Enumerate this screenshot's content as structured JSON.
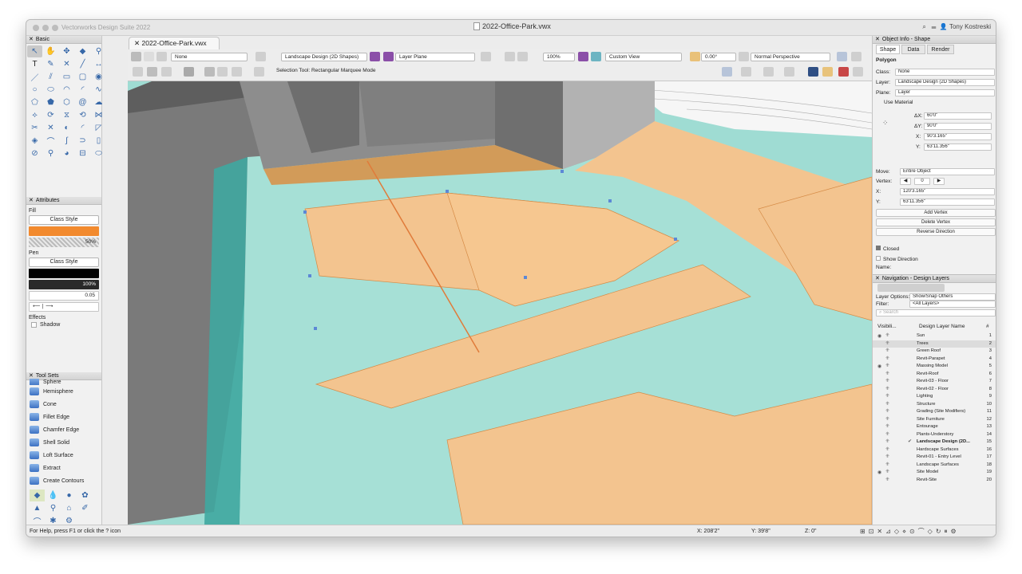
{
  "app": {
    "name": "Vectorworks Design Suite 2022",
    "document": "2022-Office-Park.vwx",
    "user": "Tony Kostreski"
  },
  "palettes": {
    "basic": {
      "title": "Basic"
    },
    "attributes": {
      "title": "Attributes",
      "fill_label": "Fill",
      "fill_style": "Class Style",
      "fill_color": "#f28a2e",
      "opacity": "50%",
      "pen_label": "Pen",
      "pen_style": "Class Style",
      "pen_opacity": "100%",
      "line_weight": "0.05",
      "effects_label": "Effects",
      "shadow_label": "Shadow"
    },
    "toolsets": {
      "title": "Tool Sets",
      "items": [
        "Sphere",
        "Hemisphere",
        "Cone",
        "Fillet Edge",
        "Chamfer Edge",
        "Shell Solid",
        "Loft Surface",
        "Extract",
        "Create Contours"
      ]
    }
  },
  "toolbar": {
    "class_value": "None",
    "layer_value": "Landscape Design (2D Shapes)",
    "plane_value": "Layer Plane",
    "zoom": "100%",
    "view": "Custom View",
    "angle": "0.00°",
    "render": "Normal Perspective",
    "mode_text": "Selection Tool: Rectangular Marquee Mode"
  },
  "object_info": {
    "title": "Object Info - Shape",
    "tabs": [
      "Shape",
      "Data",
      "Render"
    ],
    "type": "Polygon",
    "class_label": "Class:",
    "class_value": "None",
    "layer_label": "Layer:",
    "layer_value": "Landscape Design (2D Shapes)",
    "plane_label": "Plane:",
    "plane_value": "Layer",
    "use_material": "Use Material",
    "dx_label": "ΔX:",
    "dx": "60'0\"",
    "dy_label": "ΔY:",
    "dy": "90'0\"",
    "x_label": "X:",
    "x": "90'3.165\"",
    "y_label": "Y:",
    "y": "63'11.356\"",
    "move_label": "Move:",
    "move_value": "Entire Object",
    "vertex_label": "Vertex:",
    "vertex_value": "0",
    "vx_label": "X:",
    "vx": "120'3.165\"",
    "vy_label": "Y:",
    "vy": "63'11.356\"",
    "buttons": [
      "Add Vertex",
      "Delete Vertex",
      "Reverse Direction"
    ],
    "closed": "Closed",
    "show_direction": "Show Direction",
    "name_label": "Name:"
  },
  "navigation": {
    "title": "Navigation - Design Layers",
    "layer_options_label": "Layer Options:",
    "layer_options": "Show/Snap Others",
    "filter_label": "Filter:",
    "filter": "<All Layers>",
    "search_placeholder": "Search",
    "col_vis": "Visibili...",
    "col_name": "Design Layer Name",
    "col_num": "#",
    "layers": [
      {
        "name": "Sun",
        "num": "1"
      },
      {
        "name": "Trees",
        "num": "2"
      },
      {
        "name": "Green Roof",
        "num": "3"
      },
      {
        "name": "Revit-Parapet",
        "num": "4"
      },
      {
        "name": "Massing Model",
        "num": "5"
      },
      {
        "name": "Revit-Roof",
        "num": "6"
      },
      {
        "name": "Revit-03 - Floor",
        "num": "7"
      },
      {
        "name": "Revit-02 - Floor",
        "num": "8"
      },
      {
        "name": "Lighting",
        "num": "9"
      },
      {
        "name": "Structure",
        "num": "10"
      },
      {
        "name": "Grading (Site Modifiers)",
        "num": "11"
      },
      {
        "name": "Site Furniture",
        "num": "12"
      },
      {
        "name": "Entourage",
        "num": "13"
      },
      {
        "name": "Plants-Understory",
        "num": "14"
      },
      {
        "name": "Landscape Design (2D...",
        "num": "15"
      },
      {
        "name": "Hardscape Surfaces",
        "num": "16"
      },
      {
        "name": "Revit-01 - Entry Level",
        "num": "17"
      },
      {
        "name": "Landscape Surfaces",
        "num": "18"
      },
      {
        "name": "Site Model",
        "num": "19"
      },
      {
        "name": "Revit-Site",
        "num": "20"
      }
    ]
  },
  "status": {
    "help": "For Help, press F1 or click the ? icon",
    "x": "X: 208'2\"",
    "y": "Y: 39'8\"",
    "z": "Z: 0\""
  },
  "colors": {
    "accent": "#3a6fc4",
    "paving": "#f3c48f",
    "planting": "#9fdcd3",
    "building": "#8a8a8a"
  }
}
